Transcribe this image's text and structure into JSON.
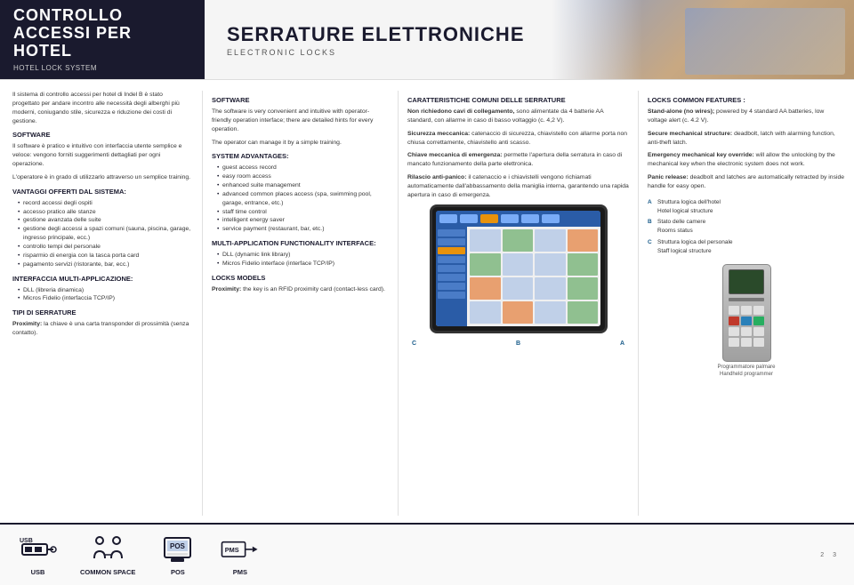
{
  "header": {
    "left": {
      "main_title": "CONTROLLO ACCESSI PER HOTEL",
      "sub_title": "HOTEL LOCK SYSTEM"
    },
    "right": {
      "main_title": "SERRATURE ELETTRONICHE",
      "sub_title": "ELECTRONIC LOCKS"
    }
  },
  "col_left": {
    "intro_text": "Il sistema di controllo accessi per hotel di Indel B è stato progettato per andare incontro alle necessità degli alberghi più moderni, coniugando stile, sicurezza e riduzione dei costi di gestione.",
    "software_title": "SOFTWARE",
    "software_text": "Il software è pratico e intuitivo con interfaccia utente semplice e veloce: vengono forniti suggerimenti dettagliati per ogni operazione.",
    "software_text2": "L'operatore è in grado di utilizzarlo attraverso un semplice training.",
    "vantaggi_title": "VANTAGGI OFFERTI DAL SISTEMA:",
    "vantaggi_items": [
      "record accessi degli ospiti",
      "accesso pratico alle stanze",
      "gestione avanzata delle suite",
      "gestione degli accessi a spazi comuni (sauna, piscina, garage, ingresso principale, ecc.)",
      "controllo tempi del personale",
      "risparmio di energia con la tasca porta card",
      "pagamento servizi (ristorante, bar, ecc.)"
    ],
    "interfaccia_title": "INTERFACCIA MULTI-APPLICAZIONE:",
    "interfaccia_items": [
      "DLL (libreria dinamica)",
      "Micros Fidelio (interfaccia TCP/IP)"
    ],
    "tipi_title": "TIPI DI SERRATURE",
    "tipi_text": "Proximity: la chiave è una carta transponder di prossimità (senza contatto)."
  },
  "col_middle": {
    "software_title": "SOFTWARE",
    "software_text": "The software is very convenient and intuitive with operator-friendly operation interface; there are detailed hints for every operation.",
    "software_text2": "The operator can manage it by a simple training.",
    "system_title": "SYSTEM ADVANTAGES:",
    "system_items": [
      "guest access record",
      "easy room access",
      "enhanced suite management",
      "advanced common places access (spa, swimming pool, garage, entrance, etc.)",
      "staff time control",
      "intelligent energy saver",
      "service payment (restaurant, bar, etc.)"
    ],
    "multi_title": "MULTI-APPLICATION FUNCTIONALITY INTERFACE:",
    "multi_items": [
      "DLL (dynamic link library)",
      "Micros Fidelio interface (interface TCP/IP)"
    ],
    "locks_title": "LOCKS MODELS",
    "locks_text": "Proximity: the key is an RFID proximity card (contact-less card)."
  },
  "col_center": {
    "caratteristiche_title": "CARATTERISTICHE COMUNI DELLE SERRATURE",
    "caratteristiche_items": [
      {
        "bold": "Non richiedono cavi di collegamento,",
        "text": " sono alimentate da 4 batterie AA standard, con allarme in caso di basso voltaggio (c. 4,2 V)."
      },
      {
        "bold": "Sicurezza meccanica:",
        "text": " catenaccio di sicurezza, chiavistello con allarme porta non chiusa correttamente, chiavistello anti scasso."
      },
      {
        "bold": "Chiave meccanica di emergenza:",
        "text": " permette l'apertura della serratura in caso di mancato funzionamento della parte elettronica."
      },
      {
        "bold": "Rilascio anti-panico:",
        "text": " il catenaccio e i chiavistelli vengono richiamati automaticamente dall'abbassamento della maniglia interna, garantendo una rapida apertura in caso di emergenza."
      }
    ],
    "abc_labels": {
      "a": "A",
      "b": "B",
      "c": "C"
    }
  },
  "col_right": {
    "locks_title": "LOCKS COMMON FEATURES :",
    "locks_items": [
      {
        "bold": "Stand-alone (no wires);",
        "text": " powered by 4 standard AA batteries, low voltage alert (c. 4.2 V)."
      },
      {
        "bold": "Secure mechanical structure:",
        "text": " deadbolt, latch with alarming function, anti-theft latch."
      },
      {
        "bold": "Emergency mechanical key override:",
        "text": " will allow the unlocking by the mechanical key when the electronic system does not work."
      },
      {
        "bold": "Panic release:",
        "text": " deadbolt and latches are automatically retracted by inside handle for easy open."
      }
    ],
    "structure_labels": [
      {
        "letter": "A",
        "text": "Struttura logica dell'hotel\nHotel logical structure"
      },
      {
        "letter": "B",
        "text": "Stato delle camere\nRooms status"
      },
      {
        "letter": "C",
        "text": "Struttura logica del personale\nStaff logical structure"
      }
    ],
    "programmer_label": "Programmatore palmare\nHandheld programmer"
  },
  "footer": {
    "icons": [
      {
        "id": "usb",
        "label": "USB"
      },
      {
        "id": "common-space",
        "label": "COMMON\nSPACE"
      },
      {
        "id": "pos",
        "label": "POS"
      },
      {
        "id": "pms",
        "label": "PMS"
      }
    ]
  },
  "page_numbers": {
    "left": "2",
    "right": "3"
  }
}
